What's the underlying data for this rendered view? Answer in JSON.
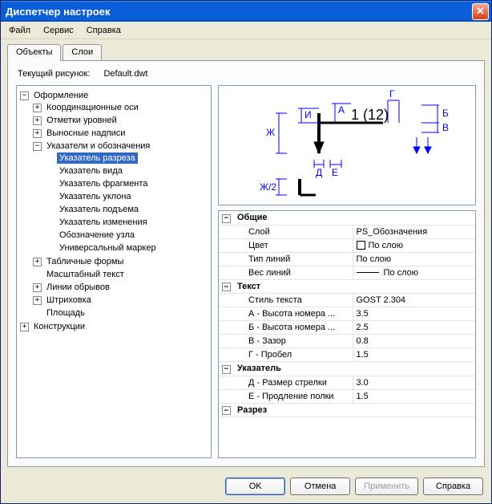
{
  "window": {
    "title": "Диспетчер настроек"
  },
  "menu": {
    "file": "Файл",
    "service": "Сервис",
    "help": "Справка"
  },
  "tabs": {
    "objects": "Объекты",
    "layers": "Слои"
  },
  "status": {
    "label": "Текущий рисунок:",
    "value": "Default.dwt"
  },
  "tree": {
    "root1": "Оформление",
    "root1_children": {
      "n0": "Координационные оси",
      "n1": "Отметки уровней",
      "n2": "Выносные надписи",
      "n3": "Указатели и обозначения",
      "n3_children": {
        "c0": "Указатель разреза",
        "c1": "Указатель вида",
        "c2": "Указатель фрагмента",
        "c3": "Указатель уклона",
        "c4": "Указатель подъема",
        "c5": "Указатель изменения",
        "c6": "Обозначение узла",
        "c7": "Универсальный маркер"
      },
      "n4": "Табличные формы",
      "n5": "Масштабный текст",
      "n6": "Линии обрывов",
      "n7": "Штриховка",
      "n8": "Площадь"
    },
    "root2": "Конструкции"
  },
  "preview": {
    "label_I": "И",
    "label_A": "А",
    "label_G": "Г",
    "label_B": "Б",
    "label_V": "В",
    "label_Zh": "Ж",
    "label_D": "Д",
    "label_E": "Е",
    "label_Zh2": "Ж/2",
    "txt_main": "1 (12)"
  },
  "props": {
    "g_general": "Общие",
    "layer_k": "Слой",
    "layer_v": "PS_Обозначения",
    "color_k": "Цвет",
    "color_v": "По слою",
    "ltype_k": "Тип линий",
    "ltype_v": "По слою",
    "lw_k": "Вес линий",
    "lw_v": "По слою",
    "g_text": "Текст",
    "tstyle_k": "Стиль текста",
    "tstyle_v": "GOST 2.304",
    "a_k": "А - Высота номера ...",
    "a_v": "3.5",
    "b_k": "Б - Высота номера ...",
    "b_v": "2.5",
    "v_k": "В - Зазор",
    "v_v": "0.8",
    "g_k": "Г - Пробел",
    "g_v": "1.5",
    "g_pointer": "Указатель",
    "d_k": "Д - Размер стрелки",
    "d_v": "3.0",
    "e_k": "Е - Продление полки",
    "e_v": "1.5",
    "g_section": "Разрез"
  },
  "buttons": {
    "ok": "OK",
    "cancel": "Отмена",
    "apply": "Применить",
    "help": "Справка"
  },
  "glyphs": {
    "minus": "−",
    "plus": "+",
    "close": "✕"
  }
}
